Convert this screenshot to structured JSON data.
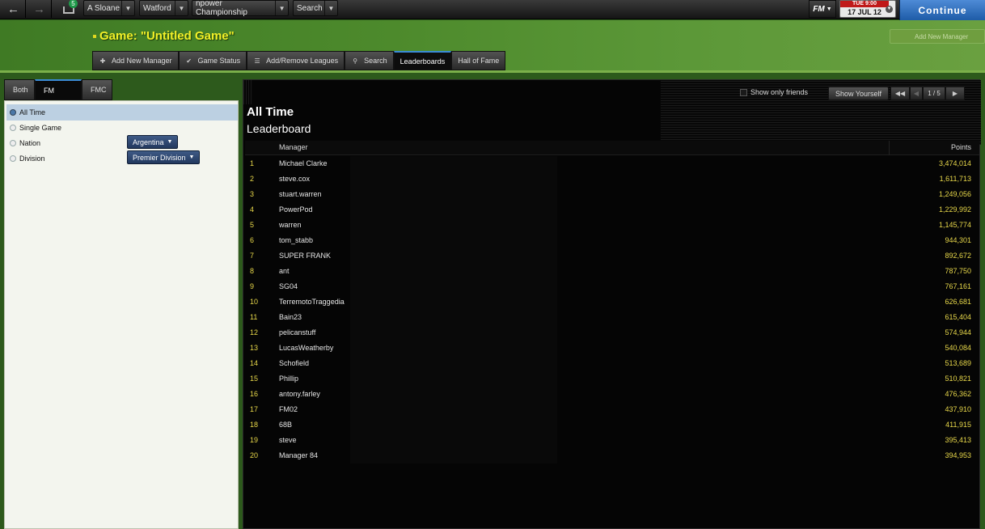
{
  "topbar": {
    "inbox_count": "5",
    "manager_label": "A Sloane",
    "club_label": "Watford",
    "competition_label": "npower Championship",
    "search_label": "Search",
    "fm_label": "FM",
    "date_day": "TUE 9:00",
    "date_text": "17 JUL 12",
    "continue_label": "Continue"
  },
  "header": {
    "title": "Game: \"Untitled Game\"",
    "add_manager_label": "Add New Manager"
  },
  "tabs": [
    {
      "label": "Add New Manager"
    },
    {
      "label": "Game Status"
    },
    {
      "label": "Add/Remove Leagues"
    },
    {
      "label": "Search"
    },
    {
      "label": "Leaderboards"
    },
    {
      "label": "Hall of Fame"
    }
  ],
  "left": {
    "tabs": [
      {
        "label": "Both"
      },
      {
        "label": "FM"
      },
      {
        "label": "FMC"
      }
    ],
    "options": [
      {
        "label": "All Time",
        "selected": true
      },
      {
        "label": "Single Game",
        "selected": false
      },
      {
        "label": "Nation",
        "selected": false
      },
      {
        "label": "Division",
        "selected": false
      }
    ],
    "nation_value": "Argentina",
    "division_value": "Premier Division"
  },
  "leaderboard": {
    "show_friends_label": "Show only friends",
    "show_yourself_label": "Show Yourself",
    "page_label": "1 / 5",
    "title_line1": "All Time",
    "title_line2": "Leaderboard",
    "col_manager": "Manager",
    "col_points": "Points",
    "rows": [
      {
        "rank": "1",
        "name": "Michael Clarke",
        "points": "3,474,014"
      },
      {
        "rank": "2",
        "name": "steve.cox",
        "points": "1,611,713"
      },
      {
        "rank": "3",
        "name": "stuart.warren",
        "points": "1,249,056"
      },
      {
        "rank": "4",
        "name": "PowerPod",
        "points": "1,229,992"
      },
      {
        "rank": "5",
        "name": "warren",
        "points": "1,145,774"
      },
      {
        "rank": "6",
        "name": "tom_stabb",
        "points": "944,301"
      },
      {
        "rank": "7",
        "name": "SUPER FRANK",
        "points": "892,672"
      },
      {
        "rank": "8",
        "name": "ant",
        "points": "787,750"
      },
      {
        "rank": "9",
        "name": "SG04",
        "points": "767,161"
      },
      {
        "rank": "10",
        "name": "TerremotoTraggedia",
        "points": "626,681"
      },
      {
        "rank": "11",
        "name": "Bain23",
        "points": "615,404"
      },
      {
        "rank": "12",
        "name": "pelicanstuff",
        "points": "574,944"
      },
      {
        "rank": "13",
        "name": "LucasWeatherby",
        "points": "540,084"
      },
      {
        "rank": "14",
        "name": "Schofield",
        "points": "513,689"
      },
      {
        "rank": "15",
        "name": "Phillip",
        "points": "510,821"
      },
      {
        "rank": "16",
        "name": "antony.farley",
        "points": "476,362"
      },
      {
        "rank": "17",
        "name": "FM02",
        "points": "437,910"
      },
      {
        "rank": "18",
        "name": "68B",
        "points": "411,915"
      },
      {
        "rank": "19",
        "name": "steve",
        "points": "395,413"
      },
      {
        "rank": "20",
        "name": "Manager 84",
        "points": "394,953"
      }
    ]
  }
}
